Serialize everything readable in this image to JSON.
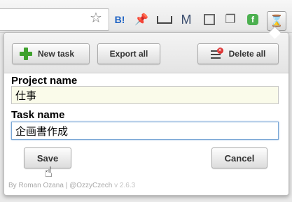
{
  "browser": {
    "bookmark_star_icon": "star-icon",
    "extensions": [
      {
        "name": "b-bookmark-extension",
        "glyph": "B!"
      },
      {
        "name": "pin-extension",
        "glyph": "📌"
      },
      {
        "name": "ruler-extension",
        "glyph": ""
      },
      {
        "name": "mail-extension",
        "glyph": "M"
      },
      {
        "name": "square-extension",
        "glyph": ""
      },
      {
        "name": "copy-extension",
        "glyph": "❐"
      },
      {
        "name": "feedly-extension",
        "glyph": "f"
      },
      {
        "name": "hourglass-extension",
        "glyph": "⌛"
      }
    ]
  },
  "popup": {
    "toolbar": {
      "new_task": "New task",
      "export_all": "Export all",
      "delete_all": "Delete all"
    },
    "form": {
      "project_label": "Project name",
      "project_value": "仕事",
      "task_label": "Task name",
      "task_value": "企画書作成"
    },
    "actions": {
      "save": "Save",
      "cancel": "Cancel"
    },
    "footer": {
      "credit": "By Roman Ozana | @OzzyCzech",
      "version": "v 2.6.3"
    }
  },
  "colors": {
    "accent_green": "#3ea12c",
    "delete_red": "#dd3333",
    "focus_blue": "#7aa7d6"
  }
}
